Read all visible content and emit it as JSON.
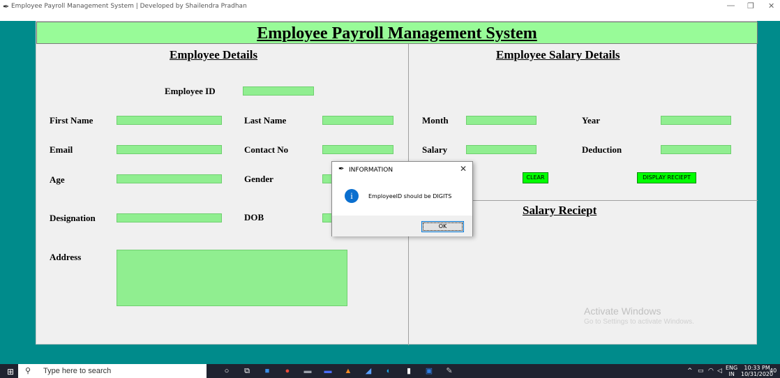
{
  "window": {
    "title": "Employee Payroll Management System | Developed by Shailendra Pradhan",
    "minimize": "—",
    "restore": "❐",
    "close": "✕"
  },
  "app": {
    "header": "Employee Payroll Management System",
    "employee_details": {
      "title": "Employee Details",
      "employee_id_label": "Employee ID",
      "first_name_label": "First Name",
      "last_name_label": "Last Name",
      "email_label": "Email",
      "contact_label": "Contact No",
      "age_label": "Age",
      "gender_label": "Gender",
      "designation_label": "Designation",
      "dob_label": "DOB",
      "address_label": "Address"
    },
    "salary_details": {
      "title": "Employee Salary Details",
      "month_label": "Month",
      "year_label": "Year",
      "salary_label": "Salary",
      "deduction_label": "Deduction",
      "clear_button": "CLEAR",
      "display_button": "DISPLAY RECIEPT"
    },
    "receipt": {
      "title": "Salary Reciept"
    }
  },
  "watermark": {
    "line1": "Activate Windows",
    "line2": "Go to Settings to activate Windows."
  },
  "dialog": {
    "title": "INFORMATION",
    "message": "EmployeeID should be DIGITS",
    "ok_button": "OK",
    "close": "✕",
    "info_glyph": "i"
  },
  "taskbar": {
    "search_placeholder": "Type here to search",
    "language": "ENG",
    "region": "IN",
    "time": "10:33 PM",
    "date": "10/31/2020",
    "notification_count": "40"
  },
  "colors": {
    "background": "#008b8b",
    "header_bg": "#98fb98",
    "field_bg": "#90ee90",
    "button_bg": "#00ff00"
  }
}
